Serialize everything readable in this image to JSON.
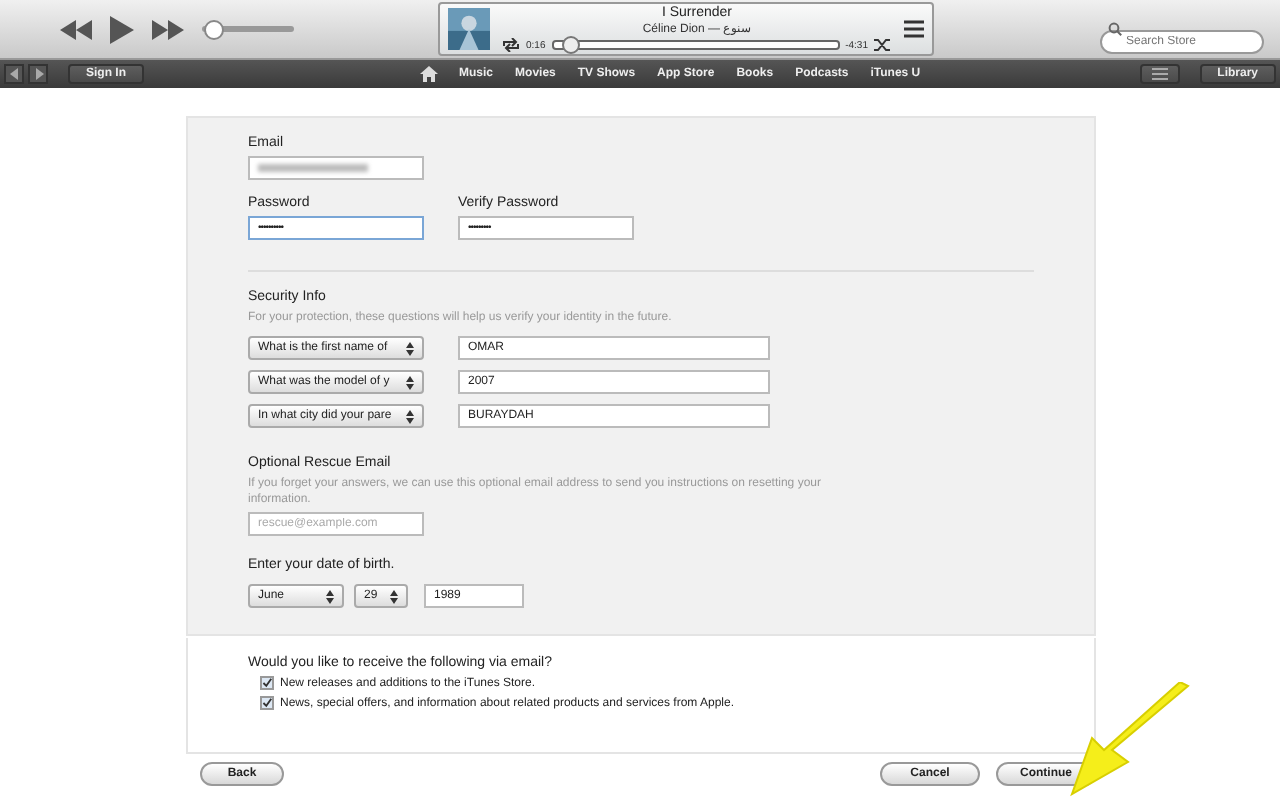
{
  "player": {
    "song": "I Surrender",
    "artist": "Céline Dion — سنوع",
    "elapsed": "0:16",
    "remaining": "-4:31",
    "volume": {
      "level": 0.1
    },
    "progress": {
      "level": 0.06
    }
  },
  "search": {
    "placeholder": "Search Store"
  },
  "nav": {
    "sign_in": "Sign In",
    "items": [
      "Music",
      "Movies",
      "TV Shows",
      "App Store",
      "Books",
      "Podcasts",
      "iTunes U"
    ],
    "library": "Library"
  },
  "form": {
    "email_label": "Email",
    "password_label": "Password",
    "password": "••••••••••",
    "verify_label": "Verify Password",
    "verify": "•••••••••",
    "security_title": "Security Info",
    "security_help": "For your protection, these questions will help us verify your identity in the future.",
    "questions": [
      {
        "question": "What is the first name of",
        "answer": "OMAR"
      },
      {
        "question": "What was the model of y",
        "answer": "2007"
      },
      {
        "question": "In what city did your pare",
        "answer": "BURAYDAH"
      }
    ],
    "rescue_title": "Optional Rescue Email",
    "rescue_help": "If you forget your answers, we can use this optional email address to send you instructions on resetting your information.",
    "rescue_placeholder": "rescue@example.com",
    "dob_label": "Enter your date of birth.",
    "month": "June",
    "day": "29",
    "year": "1989"
  },
  "email_prefs": {
    "question": "Would you like to receive the following via email?",
    "options": [
      {
        "label": "New releases and additions to the iTunes Store.",
        "checked": true
      },
      {
        "label": "News, special offers, and information about related products and services from Apple.",
        "checked": true
      }
    ]
  },
  "buttons": {
    "back": "Back",
    "cancel": "Cancel",
    "continue": "Continue"
  }
}
